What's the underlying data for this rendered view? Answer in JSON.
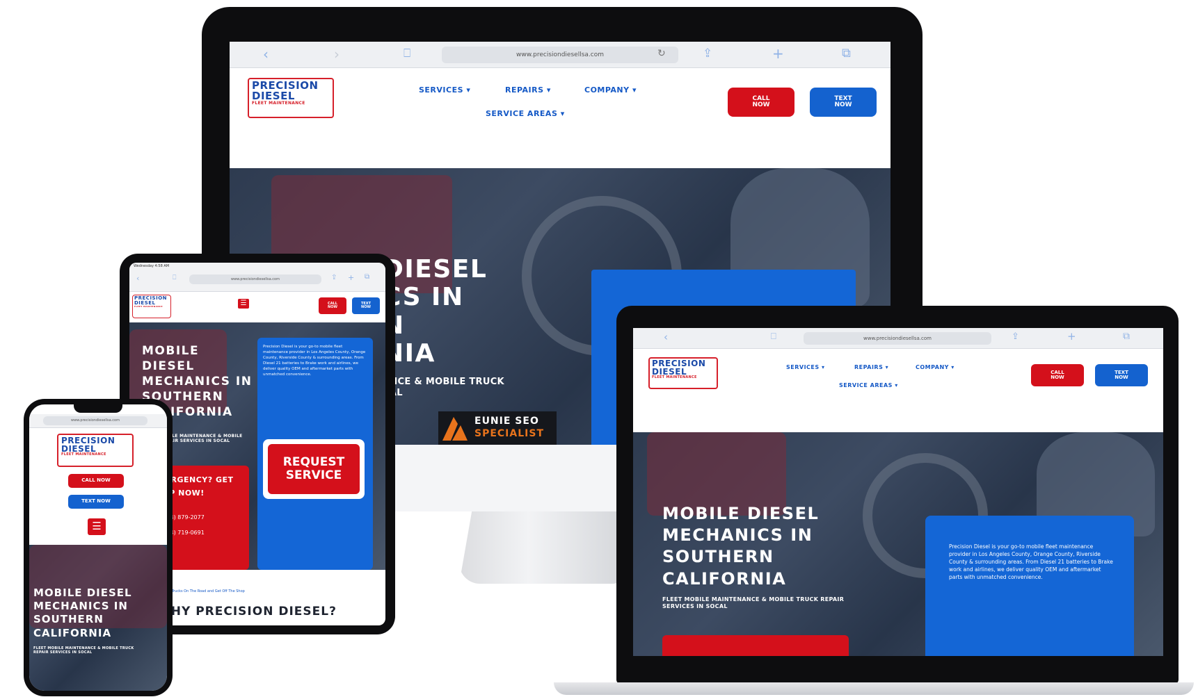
{
  "brand": {
    "line1": "PRECISION",
    "line2": "DIESEL",
    "line3": "FLEET MAINTENANCE"
  },
  "browser": {
    "url": "www.precisiondiesellsa.com"
  },
  "nav": {
    "services": "SERVICES",
    "repairs": "REPAIRS",
    "company": "COMPANY",
    "service_areas": "SERVICE AREAS",
    "caret": "▾"
  },
  "buttons": {
    "call_now": "CALL NOW",
    "text_now": "TEXT NOW",
    "request_service": "REQUEST SERVICE"
  },
  "hero": {
    "title": "MOBILE DIESEL MECHANICS IN SOUTHERN CALIFORNIA",
    "title_monitor_partial": "DIESEL\nCS IN\nN\nNIA",
    "subtitle": "FLEET MOBILE MAINTENANCE & MOBILE TRUCK REPAIR SERVICES IN SOCAL",
    "subtitle_monitor_partial": "ANCE & MOBILE TRUCK\nCAL",
    "intro": "Precision Diesel is your go-to mobile fleet maintenance provider in Los Angeles County, Orange County, Riverside County & surrounding areas. From Diesel 21 batteries to Brake work and airlines, we deliver quality OEM and aftermarket parts with unmatched convenience."
  },
  "emergency": {
    "title": "EMERGENCY? GET HELP NOW!",
    "phone1": "(714) 879-2077",
    "phone2": "(714) 719-0691"
  },
  "tablet": {
    "status": "Wednesday 4:58 AM",
    "why_heading": "WHY PRECISION DIESEL?",
    "breadcrumb": "Keep your Trucks On The Road and Get Off The Shop"
  },
  "badge": {
    "line1": "EUNIE SEO",
    "line2": "SPECIALIST"
  },
  "colors": {
    "brand_blue": "#1462cf",
    "brand_red": "#d4101b",
    "hero_dark": "#2e3b50",
    "badge_orange": "#e8731c"
  },
  "icons": {
    "back": "‹",
    "forward": "›",
    "book": "⎕",
    "share": "⇪",
    "plus": "+",
    "tabs": "⧉",
    "reload": "↻",
    "menu": "☰",
    "phone": "✆"
  }
}
